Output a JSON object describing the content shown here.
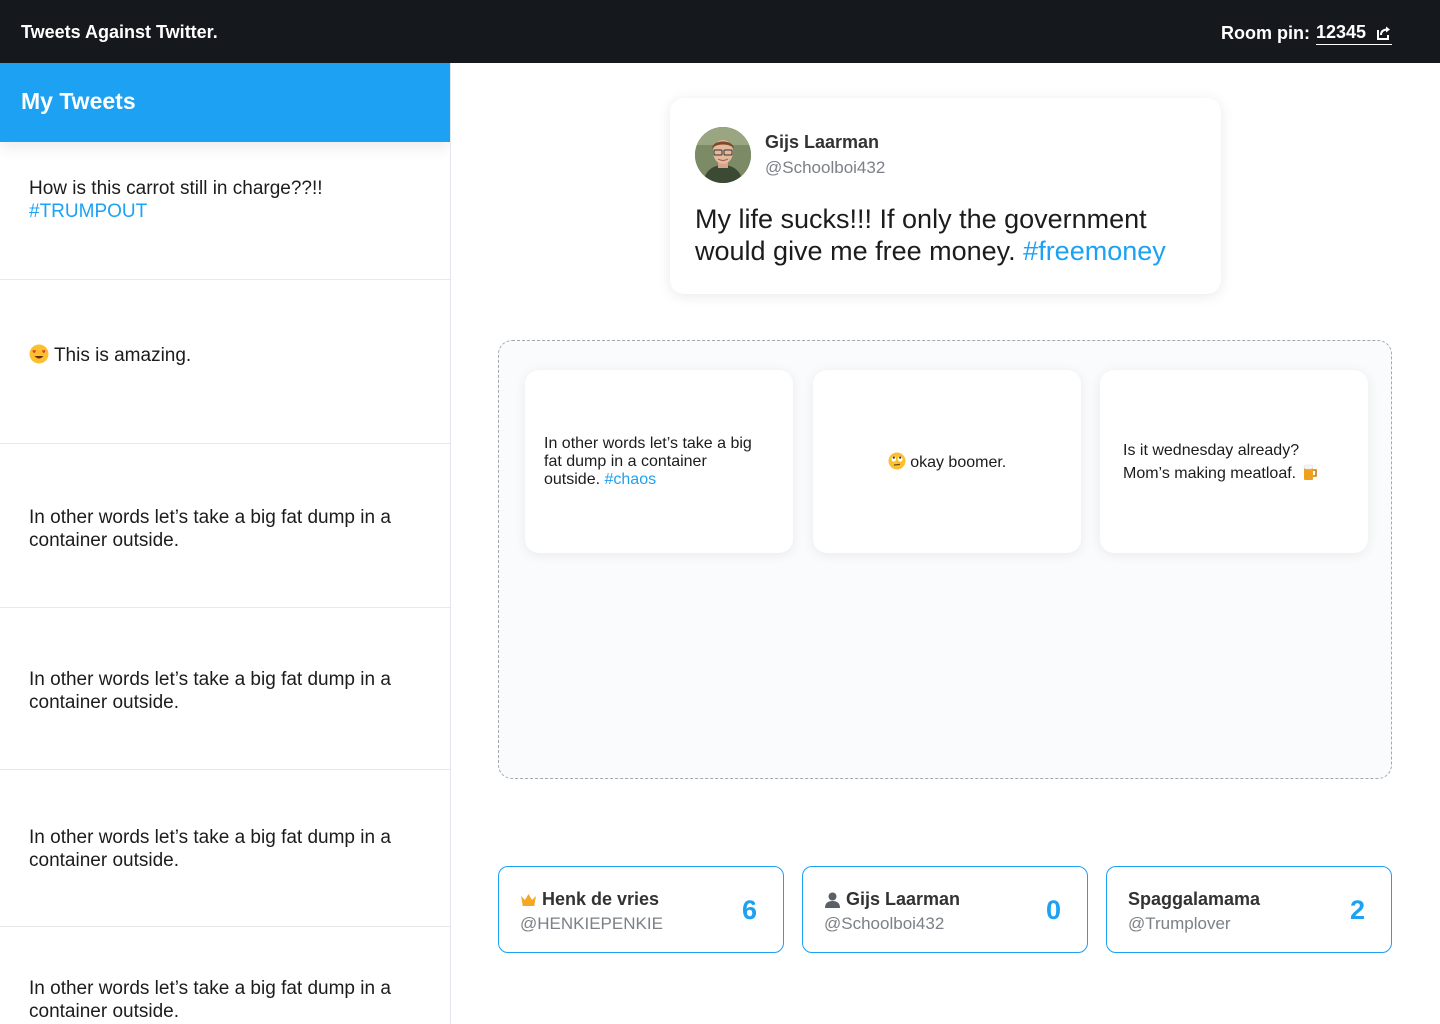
{
  "header": {
    "app_title": "Tweets Against Twitter.",
    "room_label": "Room pin:",
    "room_pin": "12345",
    "share_icon": "share-icon"
  },
  "sidebar": {
    "title": "My Tweets",
    "items": [
      {
        "text": "How is this carrot still in charge??!!",
        "hashtag": "#TRUMPOUT"
      },
      {
        "emoji": "heart-eyes-emoji",
        "text": "This is amazing."
      },
      {
        "text": "In other words let’s take a big fat dump in a container outside."
      },
      {
        "text": "In other words let’s take a big fat dump in a container outside."
      },
      {
        "text": "In other words let’s take a big fat dump in a container outside."
      },
      {
        "text": "In other words let’s take a big fat dump in a container outside."
      }
    ]
  },
  "prompt": {
    "author_name": "Gijs Laarman",
    "author_handle": "@Schoolboi432",
    "text": "My life sucks!!! If only the government would give me free money.",
    "hashtag": "#freemoney"
  },
  "answers": [
    {
      "text": "In other words let’s take a big fat dump in a container outside.",
      "hashtag": "#chaos"
    },
    {
      "emoji": "eye-roll-emoji",
      "text": "okay boomer."
    },
    {
      "line1": "Is it wednesday already?",
      "line2": "Mom’s making meatloaf.",
      "emoji": "beer-emoji"
    }
  ],
  "players": [
    {
      "name": "Henk de vries",
      "handle": "@HENKIEPENKIE",
      "score": "6",
      "icon": "crown-icon"
    },
    {
      "name": "Gijs Laarman",
      "handle": "@Schoolboi432",
      "score": "0",
      "icon": "user-icon"
    },
    {
      "name": "Spaggalamama",
      "handle": "@Trumplover",
      "score": "2"
    }
  ],
  "colors": {
    "accent": "#1da1f2",
    "topbar": "#15181c",
    "crown": "#f5a623"
  }
}
